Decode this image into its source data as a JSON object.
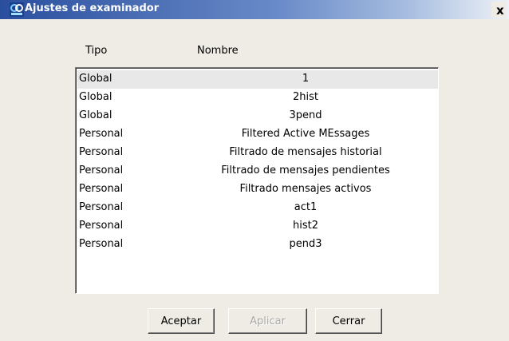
{
  "window": {
    "title": "Ajustes de examinador",
    "close_label": "x",
    "icon": "app-logo-icon"
  },
  "list": {
    "headers": {
      "tipo": "Tipo",
      "nombre": "Nombre"
    },
    "rows": [
      {
        "tipo": "Global",
        "nombre": "1",
        "selected": true
      },
      {
        "tipo": "Global",
        "nombre": "2hist"
      },
      {
        "tipo": "Global",
        "nombre": "3pend"
      },
      {
        "tipo": "Personal",
        "nombre": "Filtered Active MEssages"
      },
      {
        "tipo": "Personal",
        "nombre": "Filtrado de mensajes historial"
      },
      {
        "tipo": "Personal",
        "nombre": "Filtrado de mensajes pendientes"
      },
      {
        "tipo": "Personal",
        "nombre": "Filtrado mensajes activos"
      },
      {
        "tipo": "Personal",
        "nombre": "act1"
      },
      {
        "tipo": "Personal",
        "nombre": "hist2"
      },
      {
        "tipo": "Personal",
        "nombre": "pend3"
      }
    ]
  },
  "buttons": {
    "aceptar": "Aceptar",
    "aplicar": "Aplicar",
    "cerrar": "Cerrar"
  },
  "colors": {
    "titlebar_start": "#2a4f9e",
    "dialog_bg": "#eeece4",
    "selected_row": "#e8e8e8"
  }
}
